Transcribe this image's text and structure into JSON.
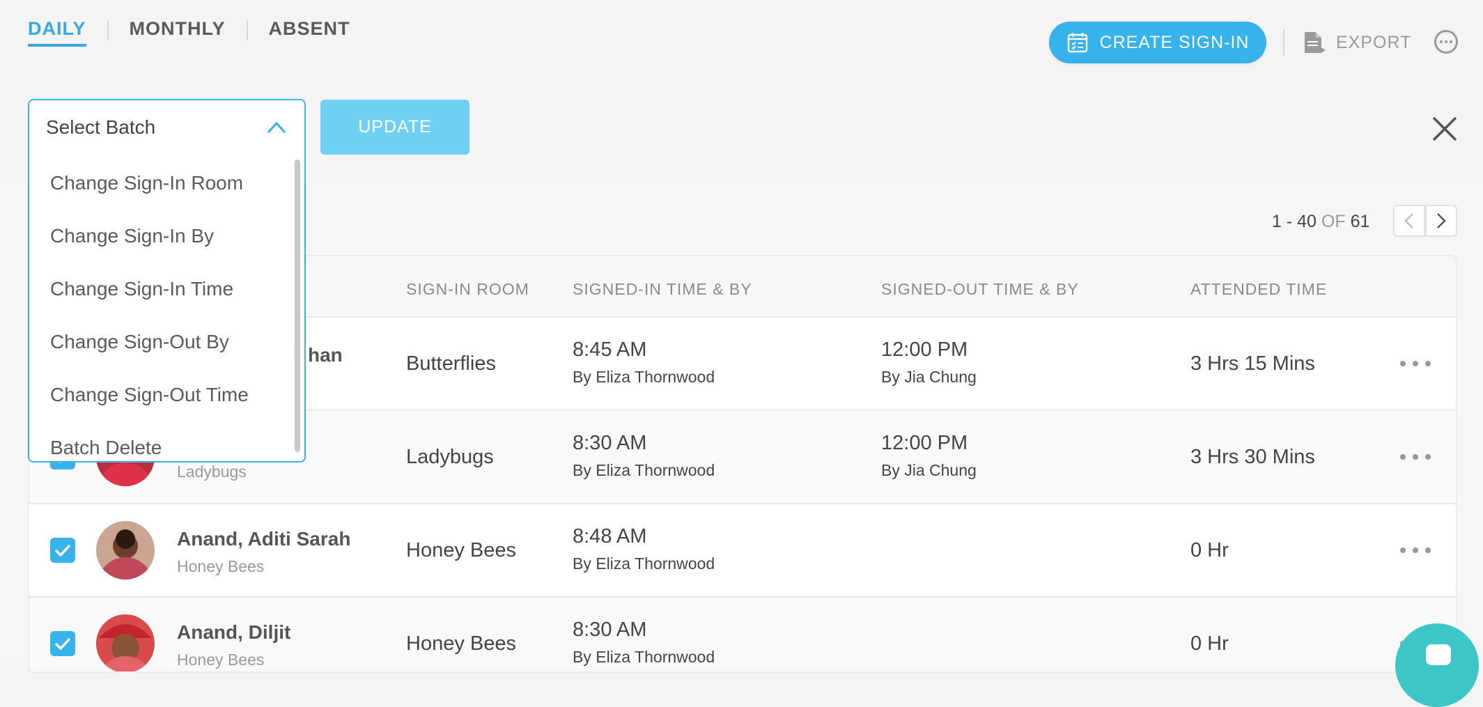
{
  "tabs": [
    {
      "label": "DAILY",
      "active": true
    },
    {
      "label": "MONTHLY",
      "active": false
    },
    {
      "label": "ABSENT",
      "active": false
    }
  ],
  "header": {
    "create_label": "CREATE SIGN-IN",
    "export_label": "EXPORT",
    "create_icon": "calendar-check-icon",
    "export_icon": "document-icon",
    "more_icon": "more-circle-icon"
  },
  "batch": {
    "select_label": "Select Batch",
    "update_label": "UPDATE",
    "options": [
      "Change Sign-In Room",
      "Change Sign-In By",
      "Change Sign-In Time",
      "Change Sign-Out By",
      "Change Sign-Out Time",
      "Batch Delete"
    ]
  },
  "pagination": {
    "range": "1 - 40",
    "of_label": "OF",
    "total": "61"
  },
  "table": {
    "headers": [
      "SIGN-IN ROOM",
      "SIGNED-IN TIME & BY",
      "SIGNED-OUT TIME & BY",
      "ATTENDED TIME"
    ],
    "rows": [
      {
        "name": "han",
        "sub_room": "",
        "room": "Butterflies",
        "in_time": "8:45 AM",
        "in_by": "By Eliza Thornwood",
        "out_time": "12:00 PM",
        "out_by": "By Jia Chung",
        "attended": "3 Hrs 15 Mins"
      },
      {
        "name": "",
        "sub_room": "Ladybugs",
        "room": "Ladybugs",
        "in_time": "8:30 AM",
        "in_by": "By Eliza Thornwood",
        "out_time": "12:00 PM",
        "out_by": "By Jia Chung",
        "attended": "3 Hrs 30 Mins"
      },
      {
        "name": "Anand, Aditi Sarah",
        "sub_room": "Honey Bees",
        "room": "Honey Bees",
        "in_time": "8:48 AM",
        "in_by": "By Eliza Thornwood",
        "out_time": "",
        "out_by": "",
        "attended": "0 Hr"
      },
      {
        "name": "Anand, Diljit",
        "sub_room": "Honey Bees",
        "room": "Honey Bees",
        "in_time": "8:30 AM",
        "in_by": "By Eliza Thornwood",
        "out_time": "",
        "out_by": "",
        "attended": "0 Hr"
      }
    ]
  },
  "colors": {
    "accent": "#36b3ea",
    "update_button": "#6fd0f2",
    "chat_bubble": "#3cc6c8"
  }
}
